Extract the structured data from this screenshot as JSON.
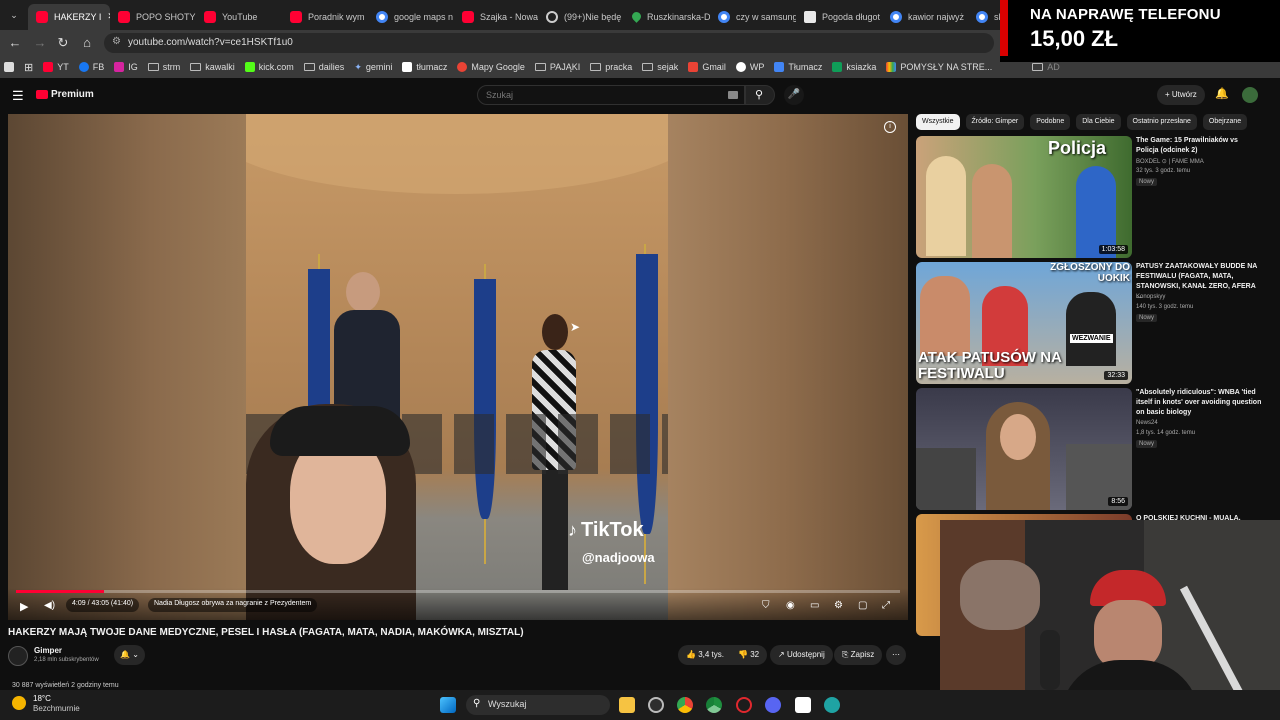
{
  "browser": {
    "tabs": [
      {
        "label": "HAKERZY I",
        "icon": "youtube-icon",
        "active": true
      },
      {
        "label": "POPO SHOTY",
        "icon": "youtube-icon"
      },
      {
        "label": "YouTube",
        "icon": "youtube-icon"
      },
      {
        "label": "Poradnik wym",
        "icon": "youtube-icon"
      },
      {
        "label": "google maps n",
        "icon": "google-icon"
      },
      {
        "label": "Szajka - Nowa",
        "icon": "youtube-icon"
      },
      {
        "label": "(99+)Nie będę",
        "icon": "generic-icon"
      },
      {
        "label": "Ruszkinarska-D",
        "icon": "map-pin-icon"
      },
      {
        "label": "czy w samsung",
        "icon": "google-icon"
      },
      {
        "label": "Pogoda długot",
        "icon": "weather-icon"
      },
      {
        "label": "kawior najwyż",
        "icon": "google-icon"
      },
      {
        "label": "ska",
        "icon": "google-icon"
      }
    ],
    "url": "youtube.com/watch?v=ce1HSKTf1u0",
    "bookmarks": [
      {
        "label": "YT",
        "icon": "youtube-icon"
      },
      {
        "label": "FB",
        "icon": "facebook-icon"
      },
      {
        "label": "IG",
        "icon": "instagram-icon"
      },
      {
        "label": "strm",
        "icon": "folder-icon"
      },
      {
        "label": "kawalki",
        "icon": "folder-icon"
      },
      {
        "label": "kick.com",
        "icon": "kick-icon"
      },
      {
        "label": "dailies",
        "icon": "folder-icon"
      },
      {
        "label": "gemini",
        "icon": "gemini-icon"
      },
      {
        "label": "tłumacz",
        "icon": "translate-icon"
      },
      {
        "label": "Mapy Google",
        "icon": "maps-icon"
      },
      {
        "label": "PAJĄKI",
        "icon": "folder-icon"
      },
      {
        "label": "pracka",
        "icon": "folder-icon"
      },
      {
        "label": "sejak",
        "icon": "folder-icon"
      },
      {
        "label": "Gmail",
        "icon": "gmail-icon"
      },
      {
        "label": "WP",
        "icon": "wp-icon"
      },
      {
        "label": "Tłumacz",
        "icon": "translate-icon"
      },
      {
        "label": "ksiazka",
        "icon": "sheet-icon"
      },
      {
        "label": "POMYSŁY NA STRE...",
        "icon": "sheet-icon"
      },
      {
        "label": "AD",
        "icon": "folder-icon"
      }
    ]
  },
  "overlay": {
    "line1": "NA NAPRAWĘ TELEFONU",
    "line2": "15,00 ZŁ"
  },
  "youtube": {
    "logo": "Premium",
    "search_placeholder": "Szukaj",
    "create_label": "Utwórz",
    "video": {
      "time": "4:09 / 43:05 (41:40)",
      "chapter": "Nadia Długosz obrywa za nagranie z Prezydentem",
      "progress": 0.1,
      "watermark_brand": "TikTok",
      "watermark_user": "@nadjoowa"
    },
    "title": "HAKERZY MAJĄ TWOJE DANE MEDYCZNE, PESEL I HASŁA (FAGATA, MATA, NADIA, MAKÓWKA, MISZTAL)",
    "channel": "Gimper",
    "subscribers": "2,18 mln subskrybentów",
    "likes": "3,4 tys.",
    "dislikes": "32",
    "share": "Udostępnij",
    "save": "Zapisz",
    "views": "30 887 wyświetleń  2 godziny temu",
    "chips": [
      "Wszystkie",
      "Źródło: Gimper",
      "Podobne",
      "Dla Ciebie",
      "Ostatnio przesłane",
      "Obejrzane"
    ],
    "related": [
      {
        "title": "The Game: 15 Prawilniaków vs Policja (odcinek 2)",
        "channel": "BOXDEL ⊙ | FAME MMA",
        "meta": "32 tys.  3 godz. temu",
        "badge": "Nowy",
        "duration": "1:03:58",
        "thumb_text": "Policja"
      },
      {
        "title": "PATUSY ZAATAKOWAŁY BUDDE NA FESTIWALU (FAGATA, MATA, STANOWSKI, KANAŁ ZERO, AFERA ...",
        "channel": "Konopskyy",
        "meta": "140 tys.  3 godz. temu",
        "badge": "Nowy",
        "duration": "32:33",
        "thumb_text": "ATAK PATUSÓW NA FESTIWALU",
        "thumb_text2": "ZGŁOSZONY DO UOKIK",
        "thumb_text3": "WEZWANIE"
      },
      {
        "title": "\"Absolutely ridiculous\": WNBA 'tied itself in knots' over avoiding question on basic biology",
        "channel": "News24",
        "meta": "1,8 tys.  14 godz. temu",
        "badge": "Nowy",
        "duration": "8:56"
      },
      {
        "title": "O POLSKIEJ KUCHNI - MUALA,",
        "channel": "",
        "meta": "",
        "badge": "",
        "duration": ""
      }
    ]
  },
  "taskbar": {
    "temp": "18°C",
    "weather": "Bezchmurnie",
    "search": "Wyszukaj"
  }
}
